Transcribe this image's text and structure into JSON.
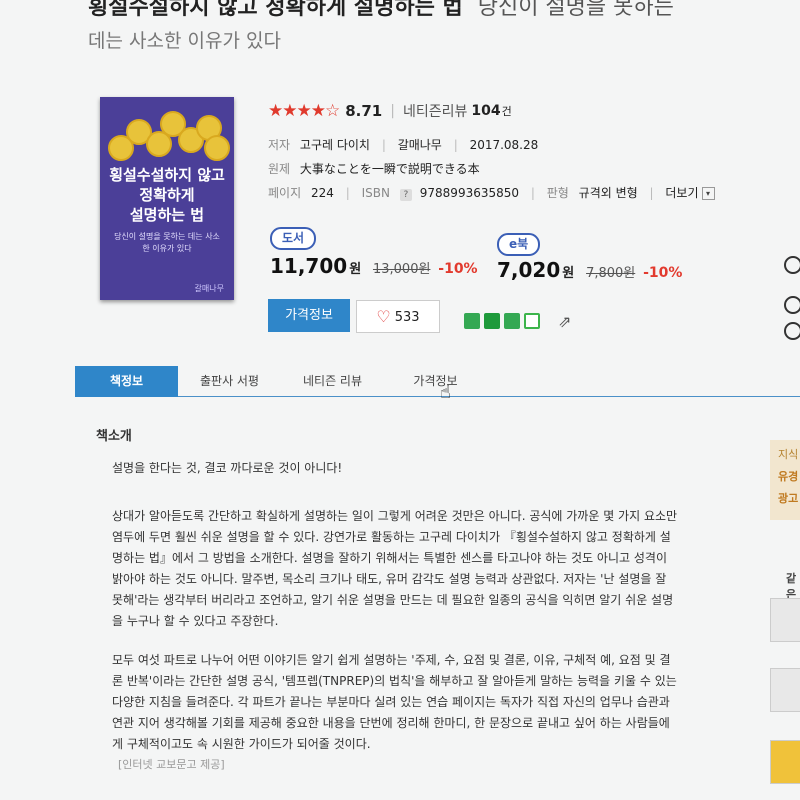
{
  "title": {
    "main": "횡설수설하지 않고 정확하게 설명하는 법",
    "sub_1": "당신이 설명을 못하는",
    "sub_2": "데는 사소한 이유가 있다"
  },
  "cover": {
    "title_line1": "횡설수설하지 않고",
    "title_line2": "정확하게",
    "title_line3": "설명하는 법",
    "subtitle": "당신이 설명을 못하는 데는 사소한 이유가 있다",
    "publisher": "갈매나무"
  },
  "rating": {
    "stars": "★★★★☆",
    "score": "8.71",
    "review_label": "네티즌리뷰",
    "review_count": "104",
    "review_unit": "건"
  },
  "info": {
    "author_label": "저자",
    "author": "고구레 다이치",
    "publisher": "갈매나무",
    "date": "2017.08.28",
    "original_label": "원제",
    "original": "大事なことを一瞬で説明できる本",
    "pages_label": "페이지",
    "pages": "224",
    "isbn_label": "ISBN",
    "isbn_help": "?",
    "isbn": "9788993635850",
    "format_label": "판형",
    "format": "규격외 변형",
    "more": "더보기"
  },
  "prices": {
    "book_badge": "도서",
    "book_price": "11,700",
    "book_won": "원",
    "book_orig": "13,000원",
    "book_disc": "-10%",
    "ebook_badge": "e북",
    "ebook_price": "7,020",
    "ebook_won": "원",
    "ebook_orig": "7,800원",
    "ebook_disc": "-10%"
  },
  "buttons": {
    "price_info": "가격정보",
    "likes": "533"
  },
  "tabs": [
    "책정보",
    "출판사 서평",
    "네티즌 리뷰",
    "가격정보"
  ],
  "section": {
    "title": "책소개",
    "p1": "설명을 한다는 것, 결코 까다로운 것이 아니다!",
    "p2_l1": "상대가 알아듣도록 간단하고 확실하게 설명하는 일이 그렇게 어려운 것만은 아니다. 공식에 가까운 몇 가지 요소만",
    "p2_l2": "염두에 두면 훨씬 쉬운 설명을 할 수 있다. 강연가로 활동하는 고구레 다이치가 『횡설수설하지 않고 정확하게 설",
    "p2_l3": "명하는 법』에서 그 방법을 소개한다. 설명을 잘하기 위해서는 특별한 센스를 타고나야 하는 것도 아니고 성격이",
    "p2_l4": "밝아야 하는 것도 아니다. 말주변, 목소리 크기나 태도, 유머 감각도 설명 능력과 상관없다. 저자는 '난 설명을 잘",
    "p2_l5": "못해'라는 생각부터 버리라고 조언하고, 알기 쉬운 설명을 만드는 데 필요한 일종의 공식을 익히면 알기 쉬운 설명",
    "p2_l6": "을 누구나 할 수 있다고 주장한다.",
    "p3_l1": "모두 여섯 파트로 나누어 어떤 이야기든 알기 쉽게 설명하는 '주제, 수, 요점 및 결론, 이유, 구체적 예, 요점 및 결",
    "p3_l2": "론 반복'이라는 간단한 설명 공식, '템프렙(TNPREP)의 법칙'을 해부하고 잘 알아듣게 말하는 능력을 키울 수 있는",
    "p3_l3": "다양한 지침을 들려준다. 각 파트가 끝나는 부분마다 실려 있는 연습 페이지는 독자가 직접 자신의 업무나 습관과",
    "p3_l4": "연관 지어 생각해볼 기회를 제공해 중요한 내용을 단번에 정리해 한마디, 한 문장으로 끝내고 싶어 하는 사람들에",
    "p3_l5": "게 구체적이고도 속 시원한 가이드가 되어줄 것이다.",
    "source": "[인터넷 교보문고 제공]"
  },
  "sidebar": {
    "ad_title": "지식",
    "ad_l1": "유경",
    "ad_l2": "광고",
    "related_label": "같은 분야"
  },
  "colors": {
    "accent": "#2f86c9",
    "discount": "#e23a2e",
    "star": "#e03a2d",
    "cover": "#4b3f98"
  }
}
